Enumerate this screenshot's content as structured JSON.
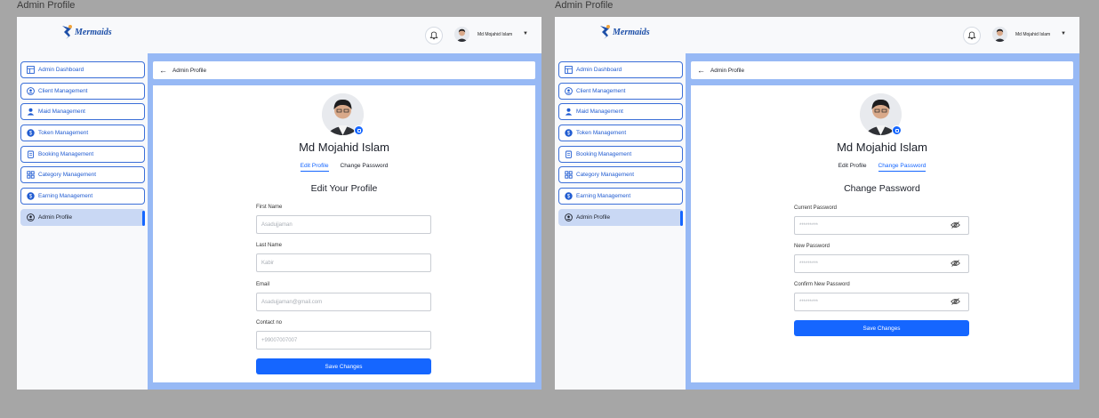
{
  "left_frame": {
    "title": "Admin Profile",
    "header": {
      "logo_text": "Mermaids",
      "user_name": "Md Mojahid Islam"
    },
    "sidebar": {
      "items": [
        {
          "label": "Admin Dashboard",
          "icon": "dashboard-icon"
        },
        {
          "label": "Client Management",
          "icon": "user-circle-icon"
        },
        {
          "label": "Maid Management",
          "icon": "user-icon"
        },
        {
          "label": "Token Management",
          "icon": "dollar-icon"
        },
        {
          "label": "Booking Management",
          "icon": "clipboard-icon"
        },
        {
          "label": "Category Management",
          "icon": "grid-icon"
        },
        {
          "label": "Earning Management",
          "icon": "dollar-icon"
        },
        {
          "label": "Admin Profile",
          "icon": "admin-icon",
          "active": true
        }
      ]
    },
    "breadcrumb": {
      "label": "Admin Profile"
    },
    "profile": {
      "name": "Md Mojahid Islam",
      "tabs": [
        "Edit Profile",
        "Change Password"
      ],
      "active_tab": "Edit Profile",
      "section_title": "Edit Your Profile",
      "fields": [
        {
          "label": "First Name",
          "placeholder": "Asadujjaman"
        },
        {
          "label": "Last Name",
          "placeholder": "Kabir"
        },
        {
          "label": "Email",
          "placeholder": "Asadujjaman@gmail.com"
        },
        {
          "label": "Contact no",
          "placeholder": "+99007007007"
        }
      ],
      "save_label": "Save Changes"
    }
  },
  "right_frame": {
    "title": "Admin Profile",
    "header": {
      "logo_text": "Mermaids",
      "user_name": "Md Mojahid Islam"
    },
    "sidebar": {
      "items": [
        {
          "label": "Admin Dashboard",
          "icon": "dashboard-icon"
        },
        {
          "label": "Client Management",
          "icon": "user-circle-icon"
        },
        {
          "label": "Maid Management",
          "icon": "user-icon"
        },
        {
          "label": "Token Management",
          "icon": "dollar-icon"
        },
        {
          "label": "Booking Management",
          "icon": "clipboard-icon"
        },
        {
          "label": "Category Management",
          "icon": "grid-icon"
        },
        {
          "label": "Earning Management",
          "icon": "dollar-icon"
        },
        {
          "label": "Admin Profile",
          "icon": "admin-icon",
          "active": true
        }
      ]
    },
    "breadcrumb": {
      "label": "Admin Profile"
    },
    "profile": {
      "name": "Md Mojahid Islam",
      "tabs": [
        "Edit Profile",
        "Change Password"
      ],
      "active_tab": "Change Password",
      "section_title": "Change Password",
      "fields": [
        {
          "label": "Current Password",
          "placeholder": "*********"
        },
        {
          "label": "New Password",
          "placeholder": "*********"
        },
        {
          "label": "Confirm New Password",
          "placeholder": "*********"
        }
      ],
      "save_label": "Save Changes"
    }
  },
  "colors": {
    "accent": "#1566ff",
    "content_bg": "#97b9f5",
    "sidebar_active": "#c9d8f4",
    "canvas": "#a6a6a6"
  }
}
